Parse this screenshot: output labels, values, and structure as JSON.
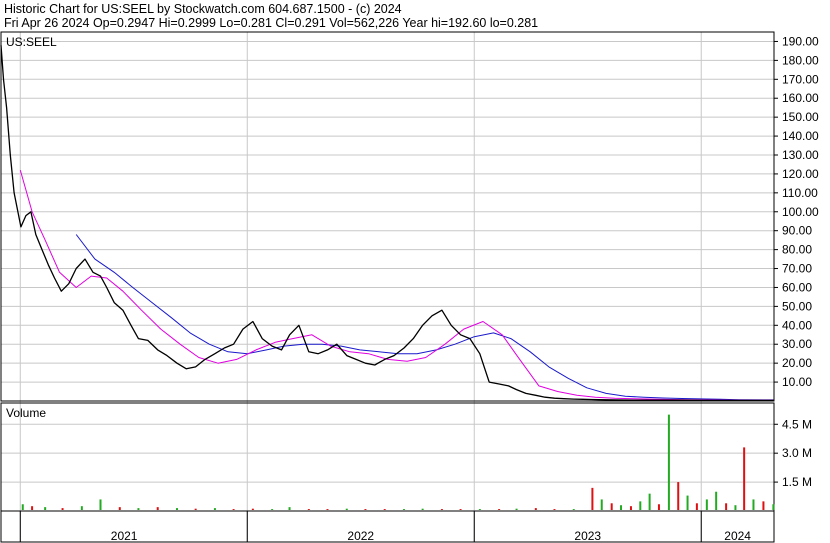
{
  "header": {
    "line1": "Historic Chart for US:SEEL by Stockwatch.com 604.687.1500 - (c) 2024",
    "line2": "Fri Apr 26 2024   Op=0.2947   Hi=0.2999   Lo=0.281   Cl=0.291   Vol=562,226   Year hi=192.60   lo=0.281"
  },
  "colors": {
    "price": "#000000",
    "ma_short": "#e000e0",
    "ma_long": "#1a1acc",
    "vol_up": "#22aa22",
    "vol_down": "#dd1111",
    "grid": "#c8c8c8"
  },
  "chart_data": [
    {
      "type": "line",
      "title": "US:SEEL",
      "ylim": [
        0,
        195
      ],
      "y_ticks": [
        "190.00",
        "180.00",
        "170.00",
        "160.00",
        "150.00",
        "140.00",
        "130.00",
        "120.00",
        "110.00",
        "100.00",
        "90.00",
        "80.00",
        "70.00",
        "60.00",
        "50.00",
        "40.00",
        "30.00",
        "20.00",
        "10.00"
      ],
      "x_labels": [
        "2021",
        "2022",
        "2023",
        "2024"
      ],
      "series": [
        {
          "key": "price",
          "x": [
            "2020-12-01",
            "2020-12-05",
            "2020-12-10",
            "2020-12-16",
            "2020-12-22",
            "2021-01-02",
            "2021-01-10",
            "2021-01-18",
            "2021-01-26",
            "2021-02-05",
            "2021-02-15",
            "2021-02-25",
            "2021-03-08",
            "2021-03-20",
            "2021-04-01",
            "2021-04-15",
            "2021-04-28",
            "2021-05-10",
            "2021-05-20",
            "2021-06-01",
            "2021-06-15",
            "2021-06-28",
            "2021-07-10",
            "2021-07-25",
            "2021-08-10",
            "2021-08-25",
            "2021-09-10",
            "2021-09-25",
            "2021-10-10",
            "2021-10-25",
            "2021-11-10",
            "2021-11-25",
            "2021-12-10",
            "2021-12-25",
            "2022-01-10",
            "2022-01-25",
            "2022-02-10",
            "2022-02-25",
            "2022-03-10",
            "2022-03-25",
            "2022-04-10",
            "2022-04-25",
            "2022-05-10",
            "2022-05-25",
            "2022-06-10",
            "2022-06-25",
            "2022-07-10",
            "2022-07-25",
            "2022-08-10",
            "2022-08-25",
            "2022-09-10",
            "2022-09-25",
            "2022-10-10",
            "2022-10-25",
            "2022-11-10",
            "2022-11-25",
            "2022-12-10",
            "2022-12-25",
            "2023-01-10",
            "2023-01-25",
            "2023-02-10",
            "2023-02-25",
            "2023-03-10",
            "2023-03-25",
            "2023-04-10",
            "2023-04-25",
            "2023-05-10",
            "2023-05-25",
            "2023-06-10",
            "2023-06-25",
            "2023-07-08",
            "2023-07-20",
            "2023-08-01",
            "2023-08-15",
            "2023-09-01",
            "2023-09-15",
            "2023-10-01",
            "2023-10-20",
            "2023-11-10",
            "2023-12-01",
            "2023-12-25",
            "2024-01-20",
            "2024-02-15",
            "2024-03-15",
            "2024-04-26"
          ],
          "values": [
            188,
            170,
            155,
            130,
            110,
            92,
            98,
            100,
            88,
            80,
            72,
            65,
            58,
            62,
            70,
            75,
            68,
            66,
            60,
            52,
            48,
            40,
            33,
            32,
            27,
            24,
            20,
            17,
            18,
            22,
            25,
            28,
            30,
            38,
            42,
            33,
            29,
            27,
            35,
            40,
            26,
            25,
            27,
            30,
            24,
            22,
            20,
            19,
            22,
            24,
            28,
            33,
            40,
            45,
            48,
            40,
            35,
            33,
            25,
            10,
            9,
            8,
            6,
            4,
            3,
            2,
            1.5,
            1.2,
            1,
            0.9,
            0.8,
            0.7,
            0.65,
            0.6,
            0.55,
            0.5,
            0.48,
            0.45,
            0.42,
            0.4,
            0.37,
            0.34,
            0.32,
            0.3,
            0.291
          ]
        },
        {
          "key": "ma_short",
          "x": [
            "2021-01-01",
            "2021-01-20",
            "2021-02-10",
            "2021-03-05",
            "2021-04-01",
            "2021-04-25",
            "2021-05-20",
            "2021-06-15",
            "2021-07-15",
            "2021-08-15",
            "2021-09-15",
            "2021-10-15",
            "2021-11-15",
            "2021-12-15",
            "2022-01-15",
            "2022-02-15",
            "2022-03-15",
            "2022-04-15",
            "2022-05-15",
            "2022-06-15",
            "2022-07-15",
            "2022-08-15",
            "2022-09-15",
            "2022-10-15",
            "2022-11-15",
            "2022-12-15",
            "2023-01-15",
            "2023-02-15",
            "2023-03-15",
            "2023-04-15",
            "2023-05-15",
            "2023-06-15",
            "2023-07-15",
            "2023-08-15",
            "2023-09-15",
            "2023-10-15",
            "2023-11-15",
            "2023-12-15",
            "2024-01-15",
            "2024-02-15",
            "2024-03-15",
            "2024-04-26"
          ],
          "values": [
            122,
            100,
            85,
            68,
            60,
            66,
            65,
            58,
            48,
            38,
            30,
            23,
            20,
            22,
            27,
            31,
            33,
            35,
            29,
            26,
            25,
            22,
            21,
            23,
            30,
            38,
            42,
            35,
            22,
            8,
            5,
            3,
            2,
            1.5,
            1.2,
            1,
            0.8,
            0.7,
            0.6,
            0.5,
            0.4,
            0.35
          ]
        },
        {
          "key": "ma_long",
          "x": [
            "2021-04-01",
            "2021-05-01",
            "2021-06-01",
            "2021-07-01",
            "2021-08-01",
            "2021-09-01",
            "2021-10-01",
            "2021-11-01",
            "2021-12-01",
            "2022-01-01",
            "2022-02-01",
            "2022-03-01",
            "2022-04-01",
            "2022-05-01",
            "2022-06-01",
            "2022-07-01",
            "2022-08-01",
            "2022-09-01",
            "2022-10-01",
            "2022-11-01",
            "2022-12-01",
            "2023-01-01",
            "2023-02-01",
            "2023-03-01",
            "2023-04-01",
            "2023-05-01",
            "2023-06-01",
            "2023-07-01",
            "2023-08-01",
            "2023-09-01",
            "2023-10-01",
            "2023-11-01",
            "2023-12-01",
            "2024-01-01",
            "2024-02-01",
            "2024-03-01",
            "2024-04-26"
          ],
          "values": [
            88,
            75,
            68,
            60,
            52,
            44,
            36,
            30,
            26,
            25,
            27,
            29,
            30,
            30,
            29,
            27,
            26,
            25,
            25,
            27,
            30,
            34,
            36,
            33,
            26,
            18,
            12,
            7,
            4,
            2.5,
            2,
            1.6,
            1.3,
            1.1,
            0.9,
            0.7,
            0.6
          ]
        }
      ]
    },
    {
      "type": "bar",
      "title": "Volume",
      "y_ticks": [
        "4.5 M",
        "3.0 M",
        "1.5 M"
      ],
      "ylim": [
        0,
        5.5
      ],
      "series": [
        {
          "key": "volume",
          "x": [
            "2021-01-05",
            "2021-01-20",
            "2021-02-10",
            "2021-03-10",
            "2021-04-10",
            "2021-05-10",
            "2021-06-10",
            "2021-07-10",
            "2021-08-10",
            "2021-09-10",
            "2021-10-10",
            "2021-11-10",
            "2021-12-10",
            "2022-01-10",
            "2022-02-10",
            "2022-03-10",
            "2022-04-10",
            "2022-05-10",
            "2022-06-10",
            "2022-07-10",
            "2022-08-10",
            "2022-09-10",
            "2022-10-10",
            "2022-11-10",
            "2022-12-10",
            "2023-01-10",
            "2023-02-10",
            "2023-03-10",
            "2023-04-10",
            "2023-05-10",
            "2023-06-10",
            "2023-07-10",
            "2023-07-25",
            "2023-08-10",
            "2023-08-25",
            "2023-09-10",
            "2023-09-25",
            "2023-10-10",
            "2023-10-25",
            "2023-11-10",
            "2023-11-25",
            "2023-12-10",
            "2023-12-25",
            "2024-01-10",
            "2024-01-25",
            "2024-02-10",
            "2024-02-25",
            "2024-03-10",
            "2024-03-25",
            "2024-04-10",
            "2024-04-26"
          ],
          "values": [
            0.35,
            0.25,
            0.2,
            0.15,
            0.25,
            0.6,
            0.2,
            0.15,
            0.2,
            0.15,
            0.12,
            0.15,
            0.1,
            0.12,
            0.1,
            0.2,
            0.1,
            0.1,
            0.12,
            0.1,
            0.1,
            0.1,
            0.12,
            0.1,
            0.1,
            0.1,
            0.1,
            0.12,
            0.15,
            0.1,
            0.1,
            1.2,
            0.6,
            0.4,
            0.3,
            0.25,
            0.5,
            0.9,
            0.35,
            5.0,
            1.5,
            0.8,
            0.4,
            0.6,
            1.0,
            0.4,
            0.3,
            3.3,
            0.6,
            0.5,
            0.35
          ],
          "up": [
            true,
            false,
            true,
            false,
            true,
            true,
            false,
            true,
            false,
            true,
            false,
            true,
            false,
            false,
            true,
            true,
            false,
            false,
            true,
            false,
            false,
            true,
            true,
            false,
            false,
            true,
            false,
            true,
            false,
            false,
            true,
            false,
            true,
            false,
            true,
            false,
            true,
            true,
            false,
            true,
            false,
            true,
            false,
            true,
            true,
            false,
            true,
            false,
            true,
            false,
            true
          ]
        }
      ]
    }
  ]
}
